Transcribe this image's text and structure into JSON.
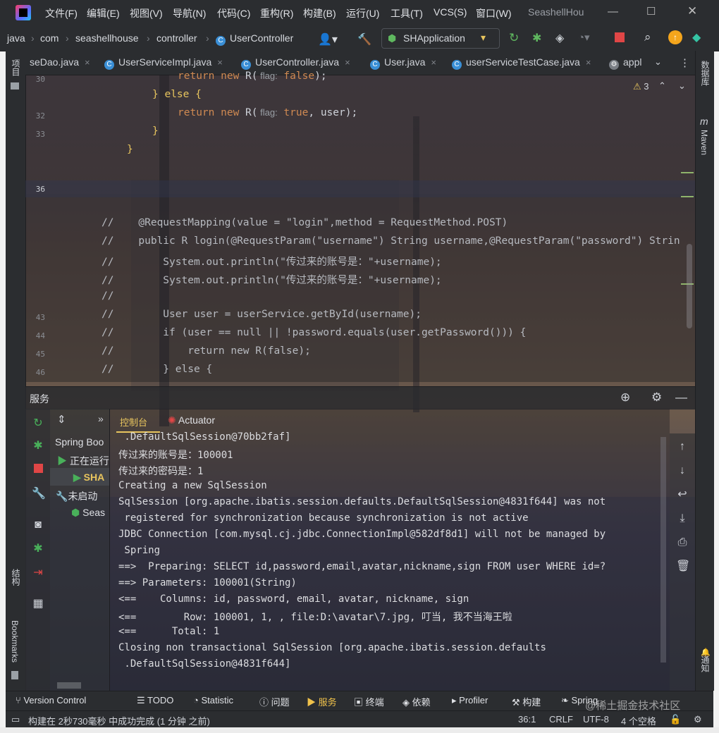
{
  "app": {
    "menus": [
      "文件(F)",
      "编辑(E)",
      "视图(V)",
      "导航(N)",
      "代码(C)",
      "重构(R)",
      "构建(B)",
      "运行(U)",
      "工具(T)",
      "VCS(S)",
      "窗口(W)"
    ],
    "project_title": "SeashellHou"
  },
  "breadcrumb": [
    "java",
    "com",
    "seashellhouse",
    "controller",
    "UserController"
  ],
  "run_config": "SHApplication",
  "tabs": [
    {
      "label": "seDao.java",
      "close": "×"
    },
    {
      "label": "UserServiceImpl.java",
      "close": "×"
    },
    {
      "label": "UserController.java",
      "close": "×"
    },
    {
      "label": "User.java",
      "close": "×"
    },
    {
      "label": "userServiceTestCase.java",
      "close": "×"
    },
    {
      "label": "appl"
    }
  ],
  "left_stripe": {
    "project": "项目",
    "structure": "结构",
    "bookmarks": "Bookmarks"
  },
  "right_stripe": {
    "database": "数据库",
    "maven": "Maven",
    "notifications": "通知"
  },
  "editor": {
    "warning_count": "3",
    "lines": [
      {
        "n": "30",
        "kw": "return new",
        "fn": " R(",
        "hint": " flag:",
        "val": " false",
        "end": ");"
      },
      {
        "n": "",
        "text": "} else {"
      },
      {
        "n": "32",
        "kw": "return new",
        "fn": " R(",
        "hint": " flag:",
        "val": " true",
        "end": ", user);"
      },
      {
        "n": "33",
        "text": "}"
      },
      {
        "n": "",
        "text": "}"
      },
      {
        "n": "36",
        "text": ""
      },
      {
        "n": "",
        "cm": "//",
        "text": "    @RequestMapping(value = \"login\",method = RequestMethod.POST)"
      },
      {
        "n": "",
        "cm": "//",
        "text": "    public R login(@RequestParam(\"username\") String username,@RequestParam(\"password\") Strin"
      },
      {
        "n": "",
        "cm": "//",
        "text": "        System.out.println(\"传过来的账号是：\"+username);"
      },
      {
        "n": "",
        "cm": "//",
        "text": "        System.out.println(\"传过来的账号是：\"+username);"
      },
      {
        "n": "",
        "cm": "//",
        "text": ""
      },
      {
        "n": "43",
        "cm": "//",
        "text": "        User user = userService.getById(username);"
      },
      {
        "n": "44",
        "cm": "//",
        "text": "        if (user == null || !password.equals(user.getPassword())) {"
      },
      {
        "n": "45",
        "cm": "//",
        "text": "            return new R(false);"
      },
      {
        "n": "46",
        "cm": "//",
        "text": "        } else {"
      }
    ]
  },
  "services": {
    "title": "服务",
    "tabs": {
      "console": "控制台",
      "actuator": "Actuator"
    },
    "tree": {
      "spring_boot": "Spring Boo",
      "running": "正在运行",
      "app": "SHA",
      "not_started": "未启动",
      "seas": "Seas"
    },
    "console_lines": [
      " .DefaultSqlSession@70bb2faf]",
      "传过来的账号是：100001",
      "传过来的密码是：1",
      "Creating a new SqlSession",
      "SqlSession [org.apache.ibatis.session.defaults.DefaultSqlSession@4831f644] was not",
      " registered for synchronization because synchronization is not active",
      "JDBC Connection [com.mysql.cj.jdbc.ConnectionImpl@582df8d1] will not be managed by",
      " Spring",
      "==>  Preparing: SELECT id,password,email,avatar,nickname,sign FROM user WHERE id=?",
      "==> Parameters: 100001(String)",
      "<==    Columns: id, password, email, avatar, nickname, sign",
      "<==        Row: 100001, 1, , file:D:\\avatar\\7.jpg, 叮当, 我不当海王啦",
      "<==      Total: 1",
      "Closing non transactional SqlSession [org.apache.ibatis.session.defaults",
      " .DefaultSqlSession@4831f644]"
    ]
  },
  "tool_windows": [
    "Version Control",
    "TODO",
    "Statistic",
    "问题",
    "服务",
    "终端",
    "依赖",
    "Profiler",
    "构建",
    "Spring"
  ],
  "watermark": "@稀土掘金技术社区",
  "status": {
    "message": "构建在 2秒730毫秒 中成功完成 (1 分钟 之前)",
    "position": "36:1",
    "line_sep": "CRLF",
    "encoding": "UTF-8",
    "indent": "4 个空格"
  },
  "colors": {
    "accent": "#3574f0",
    "keyword": "#d08a52",
    "string": "#e0a06a",
    "run": "#49b05a",
    "stop": "#e04646"
  }
}
